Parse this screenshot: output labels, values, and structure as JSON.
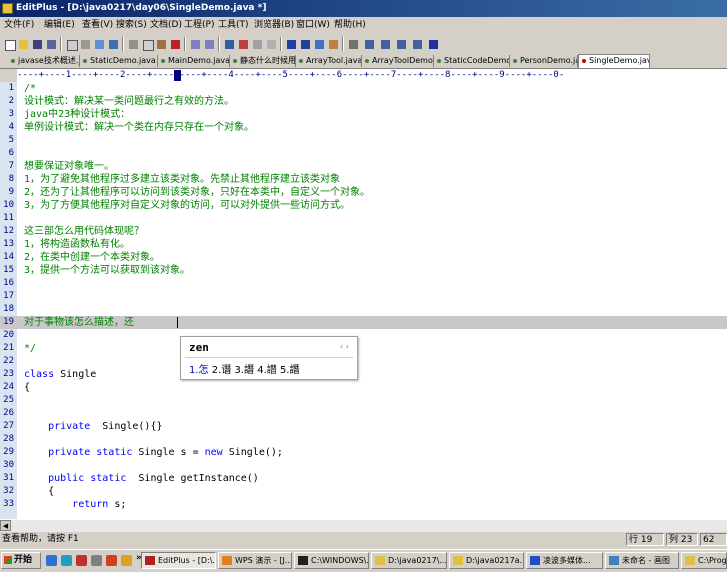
{
  "window": {
    "title": "EditPlus - [D:\\java0217\\day06\\SingleDemo.java *]"
  },
  "menu": [
    "文件(F)",
    "编辑(E)",
    "查看(V)",
    "搜索(S)",
    "文档(D)",
    "工程(P)",
    "工具(T)",
    "浏览器(B)",
    "窗口(W)",
    "帮助(H)"
  ],
  "tabs": [
    {
      "label": "javase技术概述.j"
    },
    {
      "label": "StaticDemo.java"
    },
    {
      "label": "MainDemo.java"
    },
    {
      "label": "静态什么时候用."
    },
    {
      "label": "ArrayTool.java"
    },
    {
      "label": "ArrayToolDemo.ja"
    },
    {
      "label": "StaticCodeDemo.ja"
    },
    {
      "label": "PersonDemo.java"
    },
    {
      "label": "SingleDemo.java"
    }
  ],
  "ruler": "----+----1----+----2----+----3----+----4----+----5----+----6----+----7----+----8----+----9----+----0-",
  "editor": {
    "lines": [
      {
        "n": "1",
        "text": "/*",
        "kind": "comment"
      },
      {
        "n": "2",
        "text": "设计模式：解决某一类问题最行之有效的方法。",
        "kind": "comment"
      },
      {
        "n": "3",
        "text": "java中23种设计模式：",
        "kind": "comment"
      },
      {
        "n": "4",
        "text": "单例设计模式：解决一个类在内存只存在一个对象。",
        "kind": "comment"
      },
      {
        "n": "5",
        "text": "",
        "kind": "comment"
      },
      {
        "n": "6",
        "text": "",
        "kind": "comment"
      },
      {
        "n": "7",
        "text": "想要保证对象唯一。",
        "kind": "comment"
      },
      {
        "n": "8",
        "text": "1，为了避免其他程序过多建立该类对象。先禁止其他程序建立该类对象",
        "kind": "comment"
      },
      {
        "n": "9",
        "text": "2，还为了让其他程序可以访问到该类对象，只好在本类中，自定义一个对象。",
        "kind": "comment"
      },
      {
        "n": "10",
        "text": "3，为了方便其他程序对自定义对象的访问，可以对外提供一些访问方式。",
        "kind": "comment"
      },
      {
        "n": "11",
        "text": "",
        "kind": "comment"
      },
      {
        "n": "12",
        "text": "这三部怎么用代码体现呢？",
        "kind": "comment"
      },
      {
        "n": "13",
        "text": "1，将构造函数私有化。",
        "kind": "comment"
      },
      {
        "n": "14",
        "text": "2，在类中创建一个本类对象。",
        "kind": "comment"
      },
      {
        "n": "15",
        "text": "3，提供一个方法可以获取到该对象。",
        "kind": "comment"
      },
      {
        "n": "16",
        "text": "",
        "kind": "comment"
      },
      {
        "n": "17",
        "text": "",
        "kind": "comment"
      },
      {
        "n": "18",
        "text": "",
        "kind": "comment"
      },
      {
        "n": "19",
        "text": "对于事物该怎么描述，还",
        "kind": "comment"
      },
      {
        "n": "20",
        "text": "",
        "kind": "comment"
      },
      {
        "n": "21",
        "text": "*/",
        "kind": "comment"
      },
      {
        "n": "22",
        "text": "",
        "kind": "plain"
      },
      {
        "n": "23",
        "parts": [
          [
            "class",
            "kw"
          ],
          [
            " Single",
            "tx"
          ]
        ]
      },
      {
        "n": "24",
        "text": "{",
        "kind": "plain"
      },
      {
        "n": "25",
        "text": "",
        "kind": "plain"
      },
      {
        "n": "26",
        "text": "",
        "kind": "plain"
      },
      {
        "n": "27",
        "parts": [
          [
            "    ",
            "tx"
          ],
          [
            "private",
            "kw"
          ],
          [
            "  Single(){}",
            "tx"
          ]
        ]
      },
      {
        "n": "28",
        "text": "",
        "kind": "plain"
      },
      {
        "n": "29",
        "parts": [
          [
            "    ",
            "tx"
          ],
          [
            "private static",
            "kw"
          ],
          [
            " Single s = ",
            "tx"
          ],
          [
            "new",
            "kw"
          ],
          [
            " Single();",
            "tx"
          ]
        ]
      },
      {
        "n": "30",
        "text": "",
        "kind": "plain"
      },
      {
        "n": "31",
        "parts": [
          [
            "    ",
            "tx"
          ],
          [
            "public static",
            "kw"
          ],
          [
            "  Single getInstance()",
            "tx"
          ]
        ]
      },
      {
        "n": "32",
        "text": "    {",
        "kind": "plain"
      },
      {
        "n": "33",
        "parts": [
          [
            "        ",
            "tx"
          ],
          [
            "return",
            "kw"
          ],
          [
            " s;",
            "tx"
          ]
        ]
      }
    ]
  },
  "ime": {
    "composition": "zen",
    "candidates": [
      "1.怎",
      "2.谮",
      "3.譖",
      "4.譛",
      "5.譖"
    ],
    "page_arrows": "‹ ›"
  },
  "statusbar": {
    "help": "查看帮助，请按 F1",
    "row": "行 19",
    "col": "列 23",
    "extra": "62"
  },
  "taskbar": {
    "start": "开始",
    "overflow": "»",
    "tasks": [
      {
        "label": "EditPlus - [D:\\...",
        "color": "#b02020",
        "active": true
      },
      {
        "label": "WPS 演示 - [J...",
        "color": "#e08020",
        "active": false
      },
      {
        "label": "C:\\WINDOWS\\...",
        "color": "#202020",
        "active": false
      },
      {
        "label": "D:\\java0217\\...",
        "color": "#e0c040",
        "active": false
      },
      {
        "label": "D:\\java0217a...",
        "color": "#e0c040",
        "active": false
      },
      {
        "label": "凌波多媒体...",
        "color": "#2050c0",
        "active": false
      },
      {
        "label": "未命名 - 画图",
        "color": "#4080c0",
        "active": false
      },
      {
        "label": "C:\\Progr",
        "color": "#e0c040",
        "active": false
      }
    ]
  }
}
